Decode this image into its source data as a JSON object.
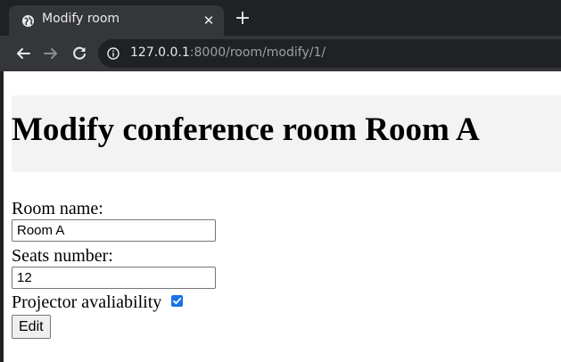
{
  "browser": {
    "tab_title": "Modify room",
    "tab_close": "✕",
    "new_tab": "+",
    "url_host": "127.0.0.1",
    "url_rest": ":8000/room/modify/1/"
  },
  "page": {
    "title": "Modify conference room Room A",
    "form": {
      "room_name_label": "Room name:",
      "room_name_value": "Room A",
      "seats_label": "Seats number:",
      "seats_value": "12",
      "projector_label": "Projector avaliability",
      "projector_checked": true,
      "submit_label": "Edit"
    }
  },
  "colors": {
    "chrome_dark": "#202124",
    "toolbar": "#35363a",
    "header_band": "#f3f3f3",
    "checkbox_accent": "#1a73e8"
  }
}
